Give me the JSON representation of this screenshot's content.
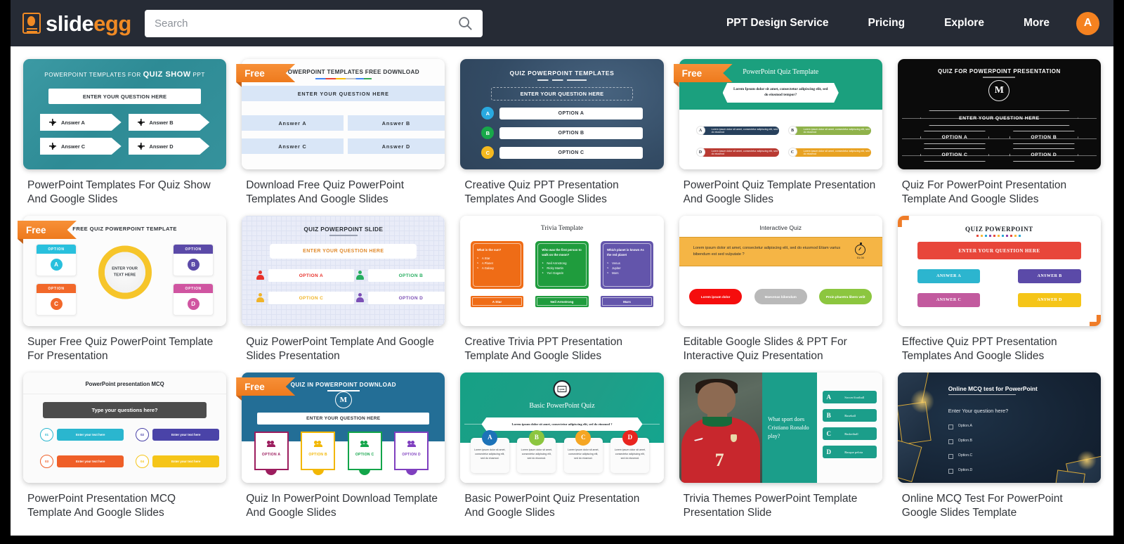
{
  "header": {
    "logo": {
      "white_part": "slide",
      "orange_part": "egg",
      "icon": "egg-logo-icon"
    },
    "search": {
      "placeholder": "Search",
      "value": "",
      "icon": "search-icon"
    },
    "nav": [
      {
        "label": "PPT Design Service"
      },
      {
        "label": "Pricing"
      },
      {
        "label": "Explore"
      },
      {
        "label": "More"
      }
    ],
    "avatar": {
      "initial": "A",
      "color": "#f58220"
    }
  },
  "badges": {
    "free": "Free"
  },
  "cards": [
    {
      "title": "PowerPoint Templates For Quiz Show And Google Slides",
      "free": false,
      "slide": {
        "heading_prefix": "POWERPOINT TEMPLATES FOR ",
        "heading_strong": "QUIZ SHOW",
        "heading_suffix": " PPT",
        "question": "ENTER YOUR QUESTION HERE",
        "answers": [
          "Answer A",
          "Answer B",
          "Answer C",
          "Answer D"
        ]
      }
    },
    {
      "title": "Download Free Quiz PowerPoint Templates And Google Slides",
      "free": true,
      "slide": {
        "heading": "QUIZ POWERPOINT TEMPLATES FREE DOWNLOAD",
        "question": "ENTER  YOUR  QUESTION  HERE",
        "answers": [
          "Answer  A",
          "Answer  B",
          "Answer  C",
          "Answer  D"
        ]
      }
    },
    {
      "title": "Creative Quiz PPT Presentation Templates And Google Slides",
      "free": false,
      "slide": {
        "heading": "QUIZ POWERPOINT TEMPLATES",
        "question": "ENTER YOUR QUESTION HERE",
        "options": [
          {
            "letter": "A",
            "label": "OPTION A",
            "color": "#29a9e0"
          },
          {
            "letter": "B",
            "label": "OPTION B",
            "color": "#18a84a"
          },
          {
            "letter": "C",
            "label": "OPTION C",
            "color": "#f5b91f"
          }
        ]
      }
    },
    {
      "title": "PowerPoint Quiz Template Presentation And Google Slides",
      "free": true,
      "slide": {
        "heading": "PowerPoint Quiz Template",
        "question": "Lorem Ipsum dolor sit amet, consectetur adipiscing elit, sed do eiusmod tempor?",
        "options": [
          {
            "letter": "A",
            "text": "Lorem ipsum dolor sit amet, consectetur adipiscing elit, sed do eiusmod",
            "color": "#27405c"
          },
          {
            "letter": "B",
            "text": "Lorem ipsum dolor sit amet, consectetur adipiscing elit, sed do eiusmod",
            "color": "#8fb24a"
          },
          {
            "letter": "D",
            "text": "Lorem ipsum dolor sit amet, consectetur adipiscing elit, sed do eiusmod",
            "color": "#b93a32"
          },
          {
            "letter": "C",
            "text": "Lorem ipsum dolor sit amet, consectetur adipiscing elit, sed do eiusmod",
            "color": "#e8a222"
          }
        ]
      }
    },
    {
      "title": "Quiz For PowerPoint Presentation Template And Google Slides",
      "free": false,
      "slide": {
        "heading": "QUIZ FOR POWERPOINT PRESENTATION",
        "monogram": "M",
        "question": "ENTER  YOUR QUESTION HERE",
        "options": [
          "OPTION  A",
          "OPTION  B",
          "OPTION  C",
          "OPTION  D"
        ]
      }
    },
    {
      "title": "Super Free Quiz PowerPoint Template For Presentation",
      "free": true,
      "slide": {
        "heading": "FREE QUIZ POWERPOINT TEMPLATE",
        "center_text_line1": "ENTER YOUR",
        "center_text_line2": "TEXT HERE",
        "options": [
          {
            "caption": "OPTION",
            "letter": "A",
            "color": "#29c0dd"
          },
          {
            "caption": "OPTION",
            "letter": "B",
            "color": "#5b4aa8"
          },
          {
            "caption": "OPTION",
            "letter": "C",
            "color": "#f2682a"
          },
          {
            "caption": "OPTION",
            "letter": "D",
            "color": "#d055a1"
          }
        ],
        "ring_color": "#f6c52a"
      }
    },
    {
      "title": "Quiz PowerPoint Template And Google Slides Presentation",
      "free": false,
      "slide": {
        "heading": "QUIZ POWERPOINT SLIDE",
        "question": "ENTER YOUR QUESTION HERE",
        "options": [
          {
            "label": "OPTION A",
            "color": "#e8322b"
          },
          {
            "label": "OPTION B",
            "color": "#27ae60"
          },
          {
            "label": "OPTION C",
            "color": "#f0b429"
          },
          {
            "label": "OPTION D",
            "color": "#7b4fb5"
          }
        ]
      }
    },
    {
      "title": "Creative Trivia PPT Presentation Template And Google Slides",
      "free": false,
      "slide": {
        "heading": "Trivia Template",
        "panels": [
          {
            "question": "What is the sun?",
            "items": [
              "A Star",
              "A Planet",
              "A Galaxy"
            ],
            "answer": "A Star",
            "color": "#ef6c16"
          },
          {
            "question": "Who was the first person to walk on the moon?",
            "items": [
              "Neil Armstrong",
              "Ricky Martin",
              "Yuri Gagarin"
            ],
            "answer": "Neil Armstrong",
            "color": "#1f9c3d"
          },
          {
            "question": "Which planet is known As the red planet",
            "items": [
              "Venus",
              "Jupiter",
              "Mars"
            ],
            "answer": "Mars",
            "color": "#6355ab"
          }
        ]
      }
    },
    {
      "title": "Editable Google Slides & PPT For Interactive Quiz Presentation",
      "free": false,
      "slide": {
        "heading": "Interactive Quiz",
        "question": "Lorem ipsum dolor sit amet, consectetur adipiscing elit, sed do eiusmod Etiam varius bibendum est sed vulputate ?",
        "timer": "01.00",
        "answers": [
          {
            "label": "Lorem ipsum dolor",
            "color": "#f50d0d"
          },
          {
            "label": "Maecenas bibendum",
            "color": "#b9b9b9"
          },
          {
            "label": "Proin pharetra libero velit",
            "color": "#8cc63f"
          }
        ]
      }
    },
    {
      "title": "Effective Quiz PPT Presentation Templates And Google Slides",
      "free": false,
      "slide": {
        "heading": "QUIZ POWERPOINT",
        "question": "ENTER YOUR QUESTION HERE",
        "answers": [
          {
            "label": "ANSWER  A",
            "color": "#2cb5cf"
          },
          {
            "label": "ANSWER B",
            "color": "#5b4aa8"
          },
          {
            "label": "ANSWER C",
            "color": "#c25a9e"
          },
          {
            "label": "ANSWER D",
            "color": "#f5c518"
          }
        ],
        "question_color": "#e8463a"
      }
    },
    {
      "title": "PowerPoint Presentation MCQ Template And Google Slides",
      "free": false,
      "slide": {
        "heading": "PowerPoint presentation MCQ",
        "question": "Type your questions here?",
        "options": [
          {
            "number": "01",
            "label": "Enter your text here",
            "color": "#2ab6cf"
          },
          {
            "number": "02",
            "label": "Enter your text here",
            "color": "#4a43a8"
          },
          {
            "number": "03",
            "label": "Enter your text here",
            "color": "#ef5f28"
          },
          {
            "number": "04",
            "label": "Enter your text here",
            "color": "#f5c518"
          }
        ]
      }
    },
    {
      "title": "Quiz In PowerPoint Download Template And Google Slides",
      "free": true,
      "slide": {
        "heading": "QUIZ IN POWERPOINT DOWNLOAD",
        "monogram": "M",
        "question": "ENTER  YOUR QUESTION HERE",
        "options": [
          {
            "label": "OPTION A",
            "color": "#9c1d5e"
          },
          {
            "label": "OPTION B",
            "color": "#f2b705"
          },
          {
            "label": "OPTION C",
            "color": "#13a54a"
          },
          {
            "label": "OPTION D",
            "color": "#7f3fbf"
          }
        ]
      }
    },
    {
      "title": "Basic PowerPoint Quiz Presentation And Google Slides",
      "free": false,
      "slide": {
        "heading": "Basic PowerPoint Quiz",
        "badge_text": "QUIZ",
        "question": "Lorem ipsum dolor sit amet, consectetur adipiscing elit, sed do eiusmod ?",
        "options": [
          {
            "letter": "A",
            "text": "Lorem ipsum dolor sit amet, consectetur adipiscing elit, sed do eiusmod.",
            "color": "#1c72b8"
          },
          {
            "letter": "B",
            "text": "Lorem ipsum dolor sit amet, consectetur adipiscing elit, sed do eiusmod.",
            "color": "#8cc63f"
          },
          {
            "letter": "C",
            "text": "Lorem ipsum dolor sit amet, consectetur adipiscing elit, sed do eiusmod.",
            "color": "#f5a623"
          },
          {
            "letter": "D",
            "text": "Lorem ipsum dolor sit amet, consectetur adipiscing elit, sed do eiusmod.",
            "color": "#e8241f"
          }
        ]
      }
    },
    {
      "title": "Trivia Themes PowerPoint Template Presentation Slide",
      "free": false,
      "slide": {
        "question": "What sport does Cristiano Ronaldo play?",
        "jersey_number": "7",
        "options": [
          {
            "letter": "A",
            "label": "Soccer/football"
          },
          {
            "letter": "B",
            "label": "Baseball"
          },
          {
            "letter": "C",
            "label": "Basketball"
          },
          {
            "letter": "D",
            "label": "Basque pelota"
          }
        ]
      }
    },
    {
      "title": "Online MCQ Test For PowerPoint Google Slides Template",
      "free": false,
      "slide": {
        "heading": "Online MCQ test for PowerPoint",
        "question": "Enter Your question here?",
        "options": [
          "Option.A",
          "Option.B",
          "Option.C",
          "Option.D"
        ]
      }
    }
  ]
}
